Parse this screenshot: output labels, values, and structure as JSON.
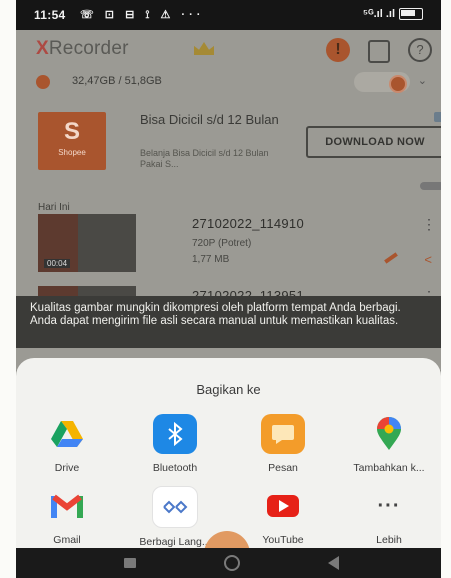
{
  "status_bar": {
    "time": "11:54",
    "left_icons": "☏ ⊡ ⊟ ⟟ ⚠ ···",
    "right_icons": "⁵ᴳ.ıl .ıl"
  },
  "app": {
    "name_part1": "X",
    "name_part2": "Recorder",
    "storage_text": "32,47GB / 51,8GB",
    "ad": {
      "brand": "Shopee",
      "title": "Bisa Dicicil s/d 12 Bulan",
      "subtitle": "Belanja Bisa Dicicil s/d 12 Bulan Pakai S...",
      "button": "DOWNLOAD NOW"
    },
    "section_label": "Hari Ini",
    "videos": [
      {
        "name": "27102022_114910",
        "quality": "720P (Potret)",
        "size": "1,77 MB",
        "duration": "00:04"
      },
      {
        "name": "27102022_113951"
      }
    ]
  },
  "toast": "Kualitas gambar mungkin dikompresi oleh platform tempat Anda berbagi. Anda dapat mengirim file asli secara manual untuk memastikan kualitas.",
  "share_sheet": {
    "title": "Bagikan ke",
    "apps": [
      {
        "label": "Drive",
        "icon": "drive-icon"
      },
      {
        "label": "Bluetooth",
        "icon": "bluetooth-icon"
      },
      {
        "label": "Pesan",
        "icon": "messages-icon"
      },
      {
        "label": "Tambahkan k...",
        "icon": "maps-icon"
      },
      {
        "label": "Gmail",
        "icon": "gmail-icon"
      },
      {
        "label": "Berbagi Lang...",
        "icon": "nearby-share-icon"
      },
      {
        "label": "YouTube",
        "icon": "youtube-icon"
      },
      {
        "label": "Lebih",
        "icon": "more-icon"
      }
    ]
  },
  "colors": {
    "accent": "#e8572a",
    "dim_overlay": "#8d8d88",
    "sheet_bg": "#f2f2ef"
  }
}
